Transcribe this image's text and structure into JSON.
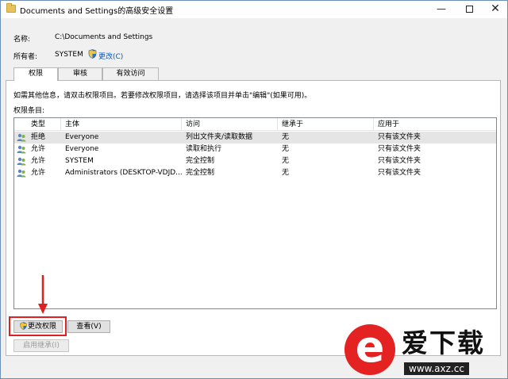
{
  "window": {
    "title": "Documents and Settings的高级安全设置",
    "minimize_glyph": "—",
    "close_glyph": "✕"
  },
  "details": {
    "name_label": "名称:",
    "name_value": "C:\\Documents and Settings",
    "owner_label": "所有者:",
    "owner_value": "SYSTEM",
    "change_owner_link": "更改(C)"
  },
  "tabs": [
    {
      "label": "权限",
      "active": true
    },
    {
      "label": "审核",
      "active": false
    },
    {
      "label": "有效访问",
      "active": false
    }
  ],
  "info_text": "如需其他信息，请双击权限项目。若要修改权限项目，请选择该项目并单击\"编辑\"(如果可用)。",
  "permissions_label": "权限条目:",
  "table": {
    "headers": [
      "类型",
      "主体",
      "访问",
      "继承于",
      "应用于"
    ],
    "rows": [
      {
        "type": "拒绝",
        "principal": "Everyone",
        "access": "列出文件夹/读取数据",
        "inherited": "无",
        "applies": "只有该文件夹",
        "selected": true
      },
      {
        "type": "允许",
        "principal": "Everyone",
        "access": "读取和执行",
        "inherited": "无",
        "applies": "只有该文件夹",
        "selected": false
      },
      {
        "type": "允许",
        "principal": "SYSTEM",
        "access": "完全控制",
        "inherited": "无",
        "applies": "只有该文件夹",
        "selected": false
      },
      {
        "type": "允许",
        "principal": "Administrators (DESKTOP-VDJD...",
        "access": "完全控制",
        "inherited": "无",
        "applies": "只有该文件夹",
        "selected": false
      }
    ]
  },
  "buttons": {
    "change_permissions": "更改权限",
    "view": "查看(V)",
    "enable_inheritance": "启用继承(I)"
  },
  "watermark": {
    "title": "爱下载",
    "url": "www.axz.cc"
  },
  "colors": {
    "link": "#0a56c2",
    "highlight": "#e02020",
    "watermark_red": "#e52222"
  }
}
